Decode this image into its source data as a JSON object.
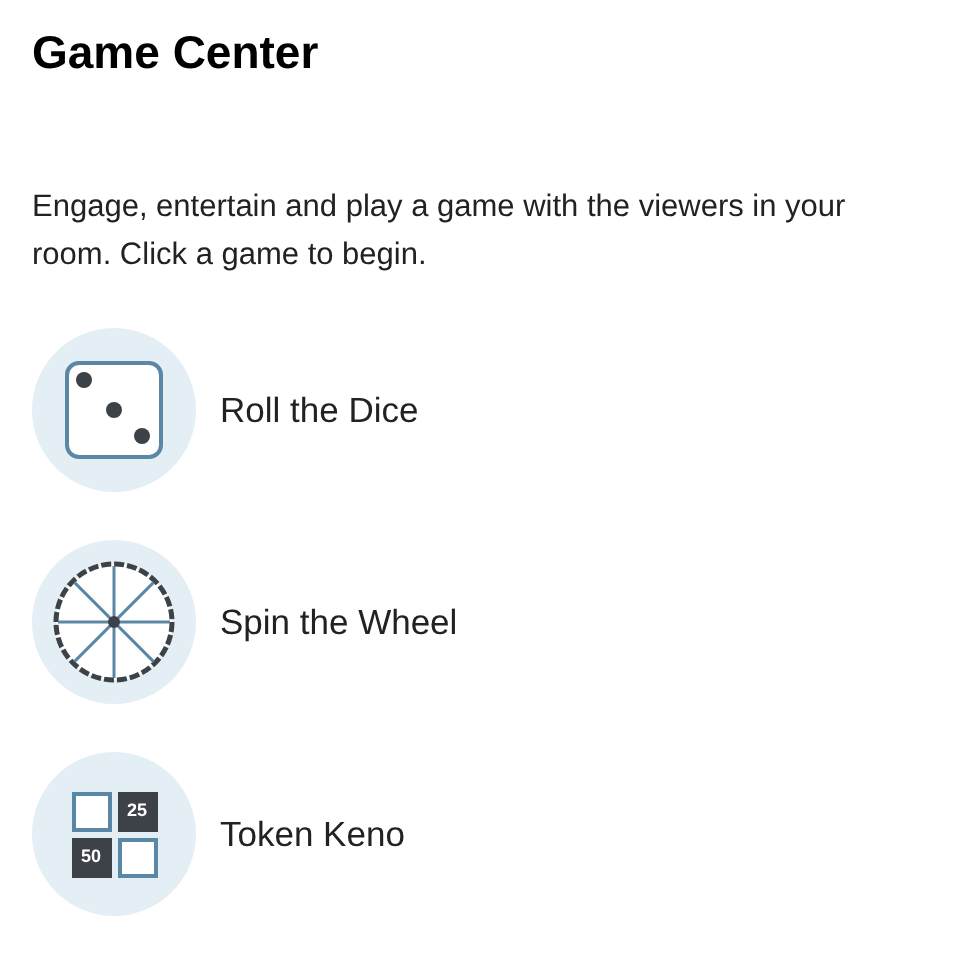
{
  "title": "Game Center",
  "description": "Engage, entertain and play a game with the viewers in your room. Click a game to begin.",
  "games": [
    {
      "kind": "dice",
      "label": "Roll the Dice"
    },
    {
      "kind": "wheel",
      "label": "Spin the Wheel"
    },
    {
      "kind": "keno",
      "label": "Token Keno",
      "tile_labels": [
        "25",
        "50"
      ]
    }
  ]
}
